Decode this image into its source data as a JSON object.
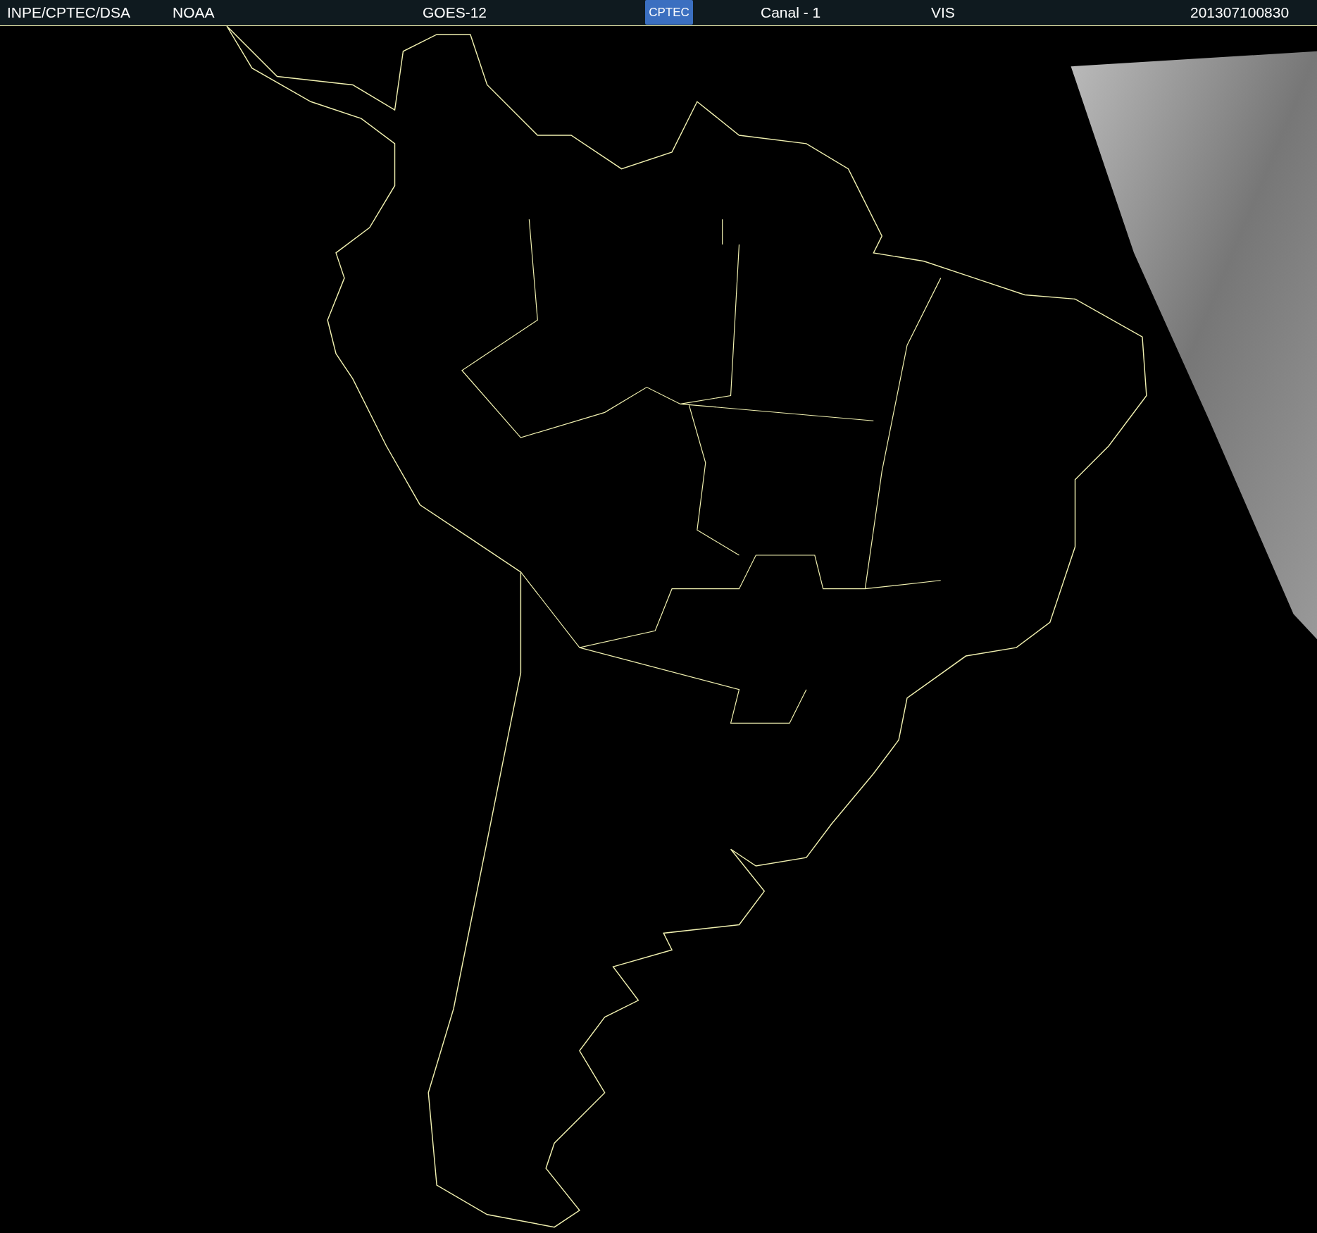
{
  "header": {
    "items": [
      "INPE/CPTEC/DSA",
      "NOAA",
      "GOES-12"
    ],
    "logo": "CPTEC",
    "right_items": [
      "Canal - 1",
      "VIS"
    ],
    "timestamp": "201307100830"
  }
}
